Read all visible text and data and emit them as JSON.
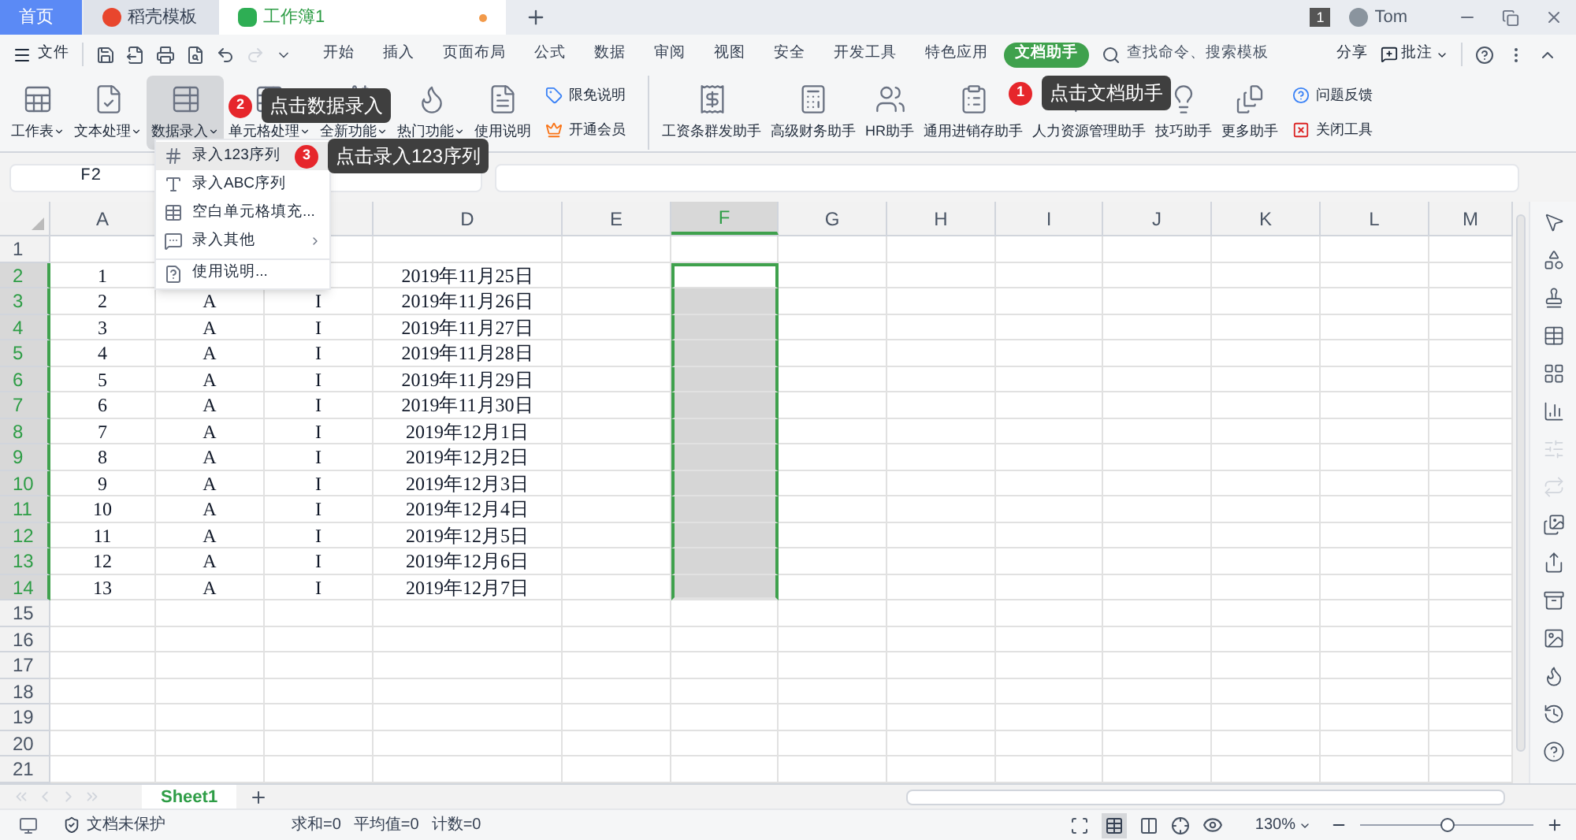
{
  "tabs": [
    {
      "label": "首页",
      "kind": "home",
      "selected": false
    },
    {
      "label": "稻壳模板",
      "kind": "docer",
      "selected": false
    },
    {
      "label": "工作簿1",
      "kind": "sheet",
      "selected": true,
      "unsaved": true
    }
  ],
  "account": {
    "badge": "1",
    "user": "Tom"
  },
  "menu": {
    "file": "文件",
    "items": [
      {
        "label": "开始",
        "selected": false
      },
      {
        "label": "插入",
        "selected": false
      },
      {
        "label": "页面布局",
        "selected": false
      },
      {
        "label": "公式",
        "selected": false
      },
      {
        "label": "数据",
        "selected": false
      },
      {
        "label": "审阅",
        "selected": false
      },
      {
        "label": "视图",
        "selected": false
      },
      {
        "label": "安全",
        "selected": false
      },
      {
        "label": "开发工具",
        "selected": false
      },
      {
        "label": "特色应用",
        "selected": false
      },
      {
        "label": "文档助手",
        "selected": true
      }
    ],
    "search": {
      "placeholder": "查找命令、搜索模板"
    },
    "share": "分享",
    "comment": "批注"
  },
  "ribbon": [
    {
      "kind": "big",
      "label": "工作表",
      "dropdown": true,
      "pressed": false
    },
    {
      "kind": "big",
      "label": "文本处理",
      "dropdown": true,
      "pressed": false
    },
    {
      "kind": "big",
      "label": "数据录入",
      "dropdown": true,
      "pressed": true
    },
    {
      "kind": "big",
      "label": "单元格处理",
      "dropdown": true,
      "pressed": false
    },
    {
      "kind": "big",
      "label": "全新功能",
      "dropdown": true,
      "pressed": false
    },
    {
      "kind": "big",
      "label": "热门功能",
      "dropdown": true,
      "pressed": false
    },
    {
      "kind": "big",
      "label": "使用说明",
      "dropdown": false,
      "pressed": false
    },
    {
      "kind": "pair",
      "items": [
        "限免说明",
        "开通会员"
      ]
    },
    {
      "kind": "big",
      "label": "工资条群发助手",
      "dropdown": false,
      "pressed": false
    },
    {
      "kind": "big",
      "label": "高级财务助手",
      "dropdown": false,
      "pressed": false
    },
    {
      "kind": "big",
      "label": "HR助手",
      "dropdown": false,
      "pressed": false
    },
    {
      "kind": "big",
      "label": "通用进销存助手",
      "dropdown": false,
      "pressed": false
    },
    {
      "kind": "big",
      "label": "人力资源管理助手",
      "dropdown": false,
      "pressed": false
    },
    {
      "kind": "big",
      "label": "技巧助手",
      "dropdown": false,
      "pressed": false
    },
    {
      "kind": "big",
      "label": "更多助手",
      "dropdown": false,
      "pressed": false
    },
    {
      "kind": "pair",
      "items": [
        "问题反馈",
        "关闭工具"
      ]
    }
  ],
  "dropdown": [
    {
      "label": "录入123序列",
      "hovered": true,
      "submenu": false,
      "divider_before": false
    },
    {
      "label": "录入ABC序列",
      "hovered": false,
      "submenu": false,
      "divider_before": false
    },
    {
      "label": "空白单元格填充...",
      "hovered": false,
      "submenu": false,
      "divider_before": false
    },
    {
      "label": "录入其他",
      "hovered": false,
      "submenu": true,
      "divider_before": false
    },
    {
      "label": "使用说明...",
      "hovered": false,
      "submenu": false,
      "divider_before": true
    }
  ],
  "callouts": [
    {
      "number": "1",
      "text": "点击文档助手"
    },
    {
      "number": "2",
      "text": "点击数据录入"
    },
    {
      "number": "3",
      "text": "点击录入123序列"
    }
  ],
  "name_box": "F2",
  "columns": [
    {
      "label": "A",
      "selected": false
    },
    {},
    {},
    {
      "label": "D",
      "selected": false
    },
    {
      "label": "E",
      "selected": false
    },
    {
      "label": "F",
      "selected": true
    },
    {
      "label": "G",
      "selected": false
    },
    {
      "label": "H",
      "selected": false
    },
    {
      "label": "I",
      "selected": false
    },
    {
      "label": "J",
      "selected": false
    },
    {
      "label": "K",
      "selected": false
    },
    {
      "label": "L",
      "selected": false
    },
    {
      "label": "M",
      "selected": false
    }
  ],
  "rows": [
    {
      "number": "1",
      "selected": false,
      "cells": {}
    },
    {
      "number": "2",
      "selected": true,
      "cells": {
        "a": "1",
        "d": "2019年11月25日"
      }
    },
    {
      "number": "3",
      "selected": true,
      "cells": {
        "a": "2",
        "b": "A",
        "c": "I",
        "d": "2019年11月26日"
      }
    },
    {
      "number": "4",
      "selected": true,
      "cells": {
        "a": "3",
        "b": "A",
        "c": "I",
        "d": "2019年11月27日"
      }
    },
    {
      "number": "5",
      "selected": true,
      "cells": {
        "a": "4",
        "b": "A",
        "c": "I",
        "d": "2019年11月28日"
      }
    },
    {
      "number": "6",
      "selected": true,
      "cells": {
        "a": "5",
        "b": "A",
        "c": "I",
        "d": "2019年11月29日"
      }
    },
    {
      "number": "7",
      "selected": true,
      "cells": {
        "a": "6",
        "b": "A",
        "c": "I",
        "d": "2019年11月30日"
      }
    },
    {
      "number": "8",
      "selected": true,
      "cells": {
        "a": "7",
        "b": "A",
        "c": "I",
        "d": "2019年12月1日"
      }
    },
    {
      "number": "9",
      "selected": true,
      "cells": {
        "a": "8",
        "b": "A",
        "c": "I",
        "d": "2019年12月2日"
      }
    },
    {
      "number": "10",
      "selected": true,
      "cells": {
        "a": "9",
        "b": "A",
        "c": "I",
        "d": "2019年12月3日"
      }
    },
    {
      "number": "11",
      "selected": true,
      "cells": {
        "a": "10",
        "b": "A",
        "c": "I",
        "d": "2019年12月4日"
      }
    },
    {
      "number": "12",
      "selected": true,
      "cells": {
        "a": "11",
        "b": "A",
        "c": "I",
        "d": "2019年12月5日"
      }
    },
    {
      "number": "13",
      "selected": true,
      "cells": {
        "a": "12",
        "b": "A",
        "c": "I",
        "d": "2019年12月6日"
      }
    },
    {
      "number": "14",
      "selected": true,
      "cells": {
        "a": "13",
        "b": "A",
        "c": "I",
        "d": "2019年12月7日"
      }
    },
    {
      "number": "15",
      "selected": false,
      "cells": {}
    },
    {
      "number": "16",
      "selected": false,
      "cells": {}
    },
    {
      "number": "17",
      "selected": false,
      "cells": {}
    },
    {
      "number": "18",
      "selected": false,
      "cells": {}
    },
    {
      "number": "19",
      "selected": false,
      "cells": {}
    },
    {
      "number": "20",
      "selected": false,
      "cells": {}
    },
    {
      "number": "21",
      "selected": false,
      "cells": {}
    }
  ],
  "sheets": [
    {
      "label": "Sheet1",
      "selected": true
    }
  ],
  "status": {
    "protection": "文档未保护",
    "sum": "求和=0",
    "average": "平均值=0",
    "count": "计数=0",
    "zoom": "130%",
    "level": 0.5
  }
}
